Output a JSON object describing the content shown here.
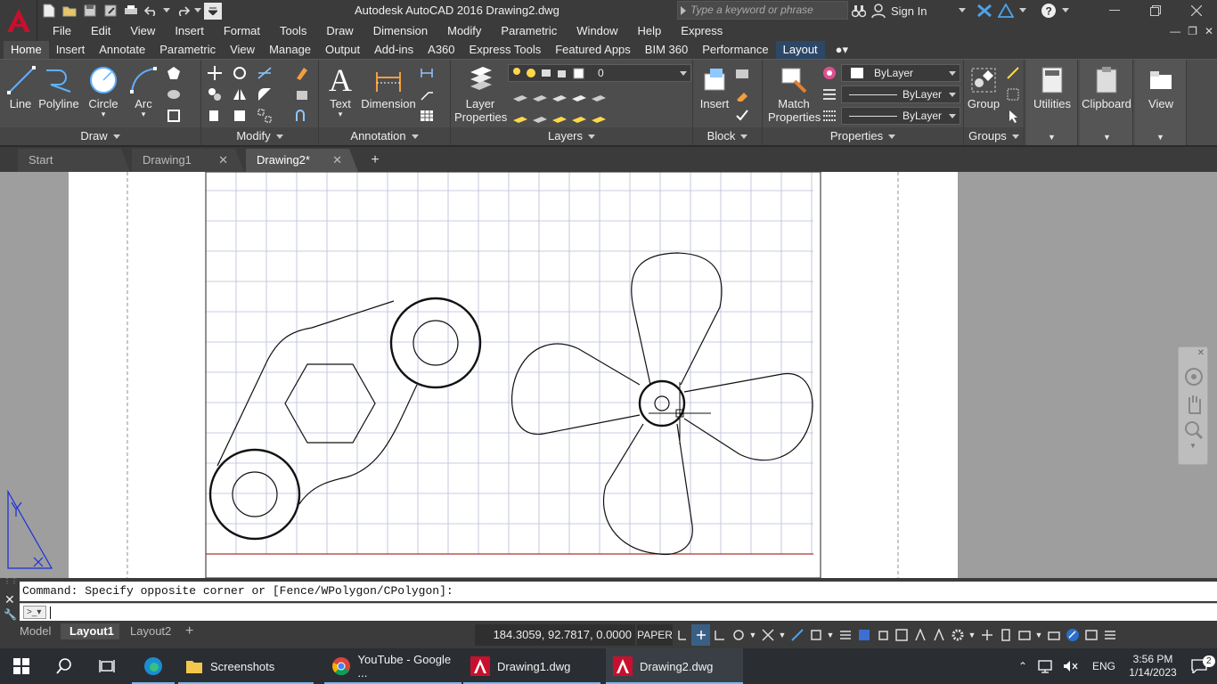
{
  "window": {
    "title": "Autodesk AutoCAD 2016    Drawing2.dwg"
  },
  "search": {
    "placeholder": "Type a keyword or phrase"
  },
  "account": {
    "signin": "Sign In"
  },
  "menu": [
    "File",
    "Edit",
    "View",
    "Insert",
    "Format",
    "Tools",
    "Draw",
    "Dimension",
    "Modify",
    "Parametric",
    "Window",
    "Help",
    "Express"
  ],
  "ribbon_tabs": [
    "Home",
    "Insert",
    "Annotate",
    "Parametric",
    "View",
    "Manage",
    "Output",
    "Add-ins",
    "A360",
    "Express Tools",
    "Featured Apps",
    "BIM 360",
    "Performance",
    "Layout"
  ],
  "ribbon": {
    "draw": {
      "title": "Draw",
      "line": "Line",
      "polyline": "Polyline",
      "circle": "Circle",
      "arc": "Arc"
    },
    "modify": {
      "title": "Modify"
    },
    "annotation": {
      "title": "Annotation",
      "text": "Text",
      "dimension": "Dimension"
    },
    "layers": {
      "title": "Layers",
      "layer_properties_1": "Layer",
      "layer_properties_2": "Properties",
      "current_layer": "0"
    },
    "block": {
      "title": "Block",
      "insert": "Insert"
    },
    "properties": {
      "title": "Properties",
      "match_1": "Match",
      "match_2": "Properties",
      "color": "ByLayer",
      "linetype": "ByLayer",
      "lineweight": "ByLayer"
    },
    "groups": {
      "title": "Groups",
      "group": "Group"
    },
    "utilities": "Utilities",
    "clipboard": "Clipboard",
    "view": "View"
  },
  "doc_tabs": [
    {
      "label": "Start"
    },
    {
      "label": "Drawing1"
    },
    {
      "label": "Drawing2*"
    }
  ],
  "command": {
    "history": "Command: Specify opposite corner or [Fence/WPolygon/CPolygon]:",
    "input": ""
  },
  "layout_tabs": [
    "Model",
    "Layout1",
    "Layout2"
  ],
  "status": {
    "coords": "184.3059, 92.7817, 0.0000",
    "space": "PAPER"
  },
  "taskbar": {
    "apps": [
      {
        "label": "Screenshots"
      },
      {
        "label": "YouTube - Google ..."
      },
      {
        "label": "Drawing1.dwg"
      },
      {
        "label": "Drawing2.dwg"
      }
    ],
    "lang": "ENG",
    "time": "3:56 PM",
    "date": "1/14/2023",
    "notifications": "2"
  },
  "colors": {
    "accent": "#2d4766",
    "autocad_red": "#c8102e",
    "layout_border": "#b03030"
  }
}
